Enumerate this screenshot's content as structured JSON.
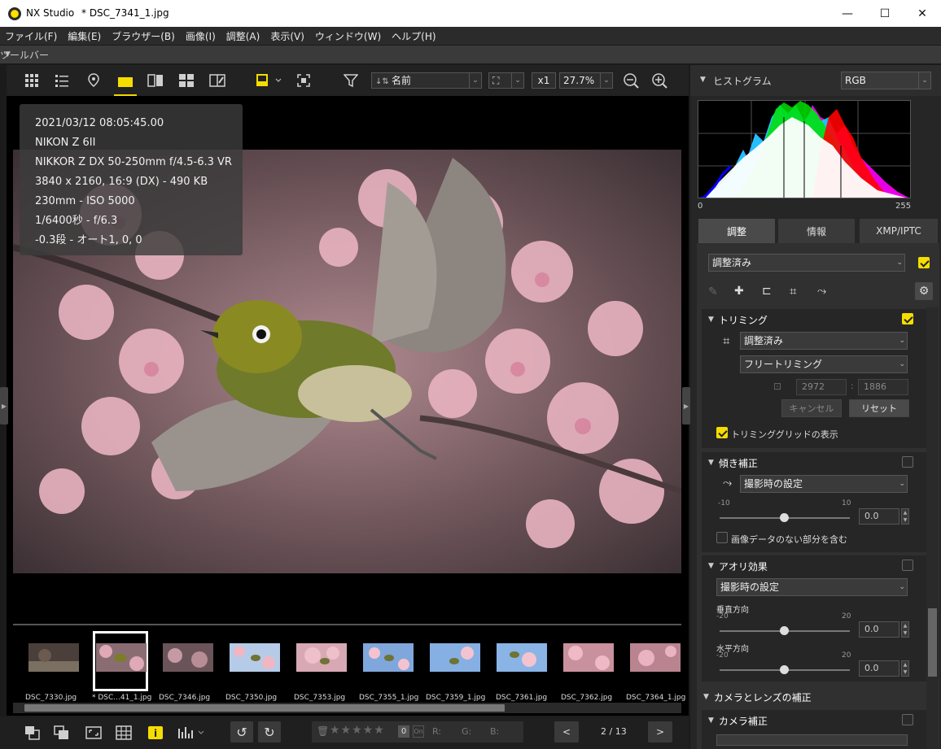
{
  "window": {
    "app_name": "NX Studio",
    "doc_title": "* DSC_7341_1.jpg",
    "minimize": "—",
    "maximize": "☐",
    "close": "✕"
  },
  "menu": [
    "ファイル(F)",
    "編集(E)",
    "ブラウザー(B)",
    "画像(I)",
    "調整(A)",
    "表示(V)",
    "ウィンドウ(W)",
    "ヘルプ(H)"
  ],
  "toolbar_header": "ツールバー",
  "toolbar": {
    "sort_label": "名前",
    "zoom_multiplier": "x1",
    "zoom_percent": "27.7%"
  },
  "info_overlay": {
    "datetime": "2021/03/12 08:05:45.00",
    "camera": "NIKON Z 6II",
    "lens": "NIKKOR Z DX 50-250mm f/4.5-6.3 VR",
    "size": "3840 x 2160, 16:9 (DX) - 490 KB",
    "focal_iso": "230mm - ISO 5000",
    "exposure": "1/6400秒 - f/6.3",
    "ev_wb": "-0.3段 - オート1, 0, 0"
  },
  "filmstrip": [
    {
      "name": "DSC_7330.jpg"
    },
    {
      "name": "* DSC...41_1.jpg"
    },
    {
      "name": "DSC_7346.jpg"
    },
    {
      "name": "DSC_7350.jpg"
    },
    {
      "name": "DSC_7353.jpg"
    },
    {
      "name": "DSC_7355_1.jpg"
    },
    {
      "name": "DSC_7359_1.jpg"
    },
    {
      "name": "DSC_7361.jpg"
    },
    {
      "name": "DSC_7362.jpg"
    },
    {
      "name": "DSC_7364_1.jpg"
    }
  ],
  "bottombar": {
    "rating_label_r": "R:",
    "rating_label_g": "G:",
    "rating_label_b": "B:",
    "rating_zero": "0",
    "page_indicator": "2 / 13",
    "prev": "<",
    "next": ">"
  },
  "histogram": {
    "title": "ヒストグラム",
    "channel": "RGB",
    "min_label": "0",
    "max_label": "255"
  },
  "tabs": [
    "調整",
    "情報",
    "XMP/IPTC"
  ],
  "adjust": {
    "preset": "調整済み",
    "trimming": {
      "title": "トリミング",
      "mode": "調整済み",
      "aspect": "フリートリミング",
      "width": "2972",
      "height": "1886",
      "separator": ":",
      "cancel": "キャンセル",
      "reset": "リセット",
      "grid_label": "トリミンググリッドの表示"
    },
    "tilt": {
      "title": "傾き補正",
      "mode": "撮影時の設定",
      "min": "-10",
      "max": "10",
      "value": "0.0",
      "include_label": "画像データのない部分を含む"
    },
    "perspective": {
      "title": "アオリ効果",
      "mode": "撮影時の設定",
      "vertical_label": "垂直方向",
      "v_min": "-20",
      "v_max": "20",
      "v_value": "0.0",
      "horizontal_label": "水平方向",
      "h_min": "-20",
      "h_max": "20",
      "h_value": "0.0"
    },
    "camera_lens_header": "カメラとレンズの補正",
    "camera_correction": "カメラ補正"
  },
  "colors": {
    "accent_yellow": "#f5dd00",
    "bg_dark": "#1b1b1b"
  }
}
